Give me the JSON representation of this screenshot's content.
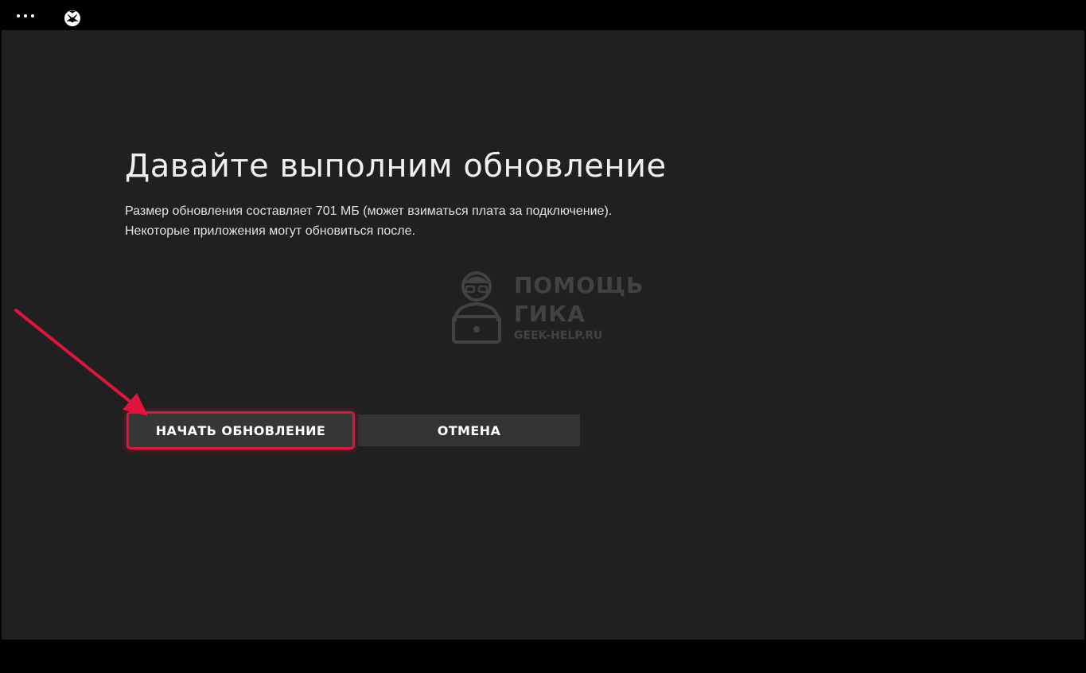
{
  "topbar": {
    "more_icon": "more-dots-icon",
    "logo_icon": "xbox-logo-icon"
  },
  "dialog": {
    "title": "Давайте выполним обновление",
    "description_line1": "Размер обновления составляет 701 МБ (может взиматься плата за подключение).",
    "description_line2": "Некоторые приложения могут обновиться после."
  },
  "buttons": {
    "start_update": "НАЧАТЬ ОБНОВЛЕНИЕ",
    "cancel": "ОТМЕНА"
  },
  "watermark": {
    "line1": "ПОМОЩЬ",
    "line2": "ГИКА",
    "site": "GEEK-HELP.RU"
  },
  "annotation": {
    "arrow_color": "#e0143c",
    "highlight_color": "#e0143c"
  },
  "colors": {
    "background": "#202020",
    "frame": "#000000",
    "button": "#363636"
  }
}
